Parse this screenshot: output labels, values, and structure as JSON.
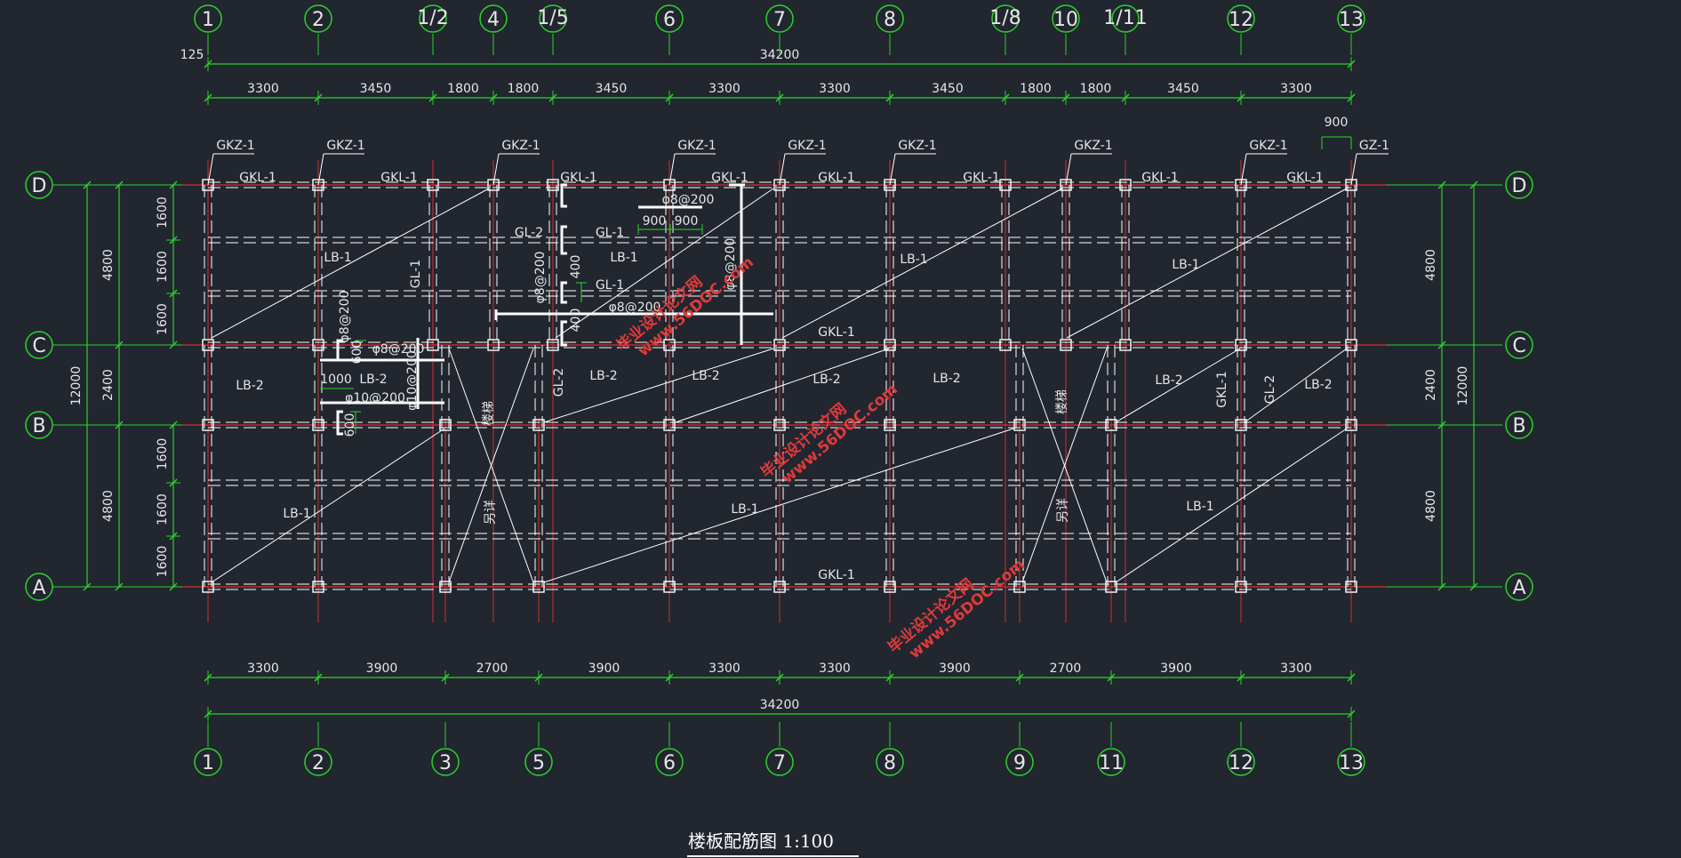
{
  "title": "楼板配筋图 1:100",
  "colors": {
    "background": "#21262f",
    "dimension": "#2bd42b",
    "axis_red": "#d62f2f",
    "beam": "#ffffff",
    "watermark": "#e03a3a"
  },
  "top_axes": [
    "1",
    "2",
    "1/2",
    "4",
    "1/5",
    "6",
    "7",
    "8",
    "1/8",
    "10",
    "1/11",
    "12",
    "13"
  ],
  "bottom_axes": [
    "1",
    "2",
    "3",
    "5",
    "6",
    "7",
    "8",
    "9",
    "11",
    "12",
    "13"
  ],
  "row_axes": [
    "D",
    "C",
    "B",
    "A"
  ],
  "top_overall": "34200",
  "top_offset": "125",
  "top_spans": [
    "3300",
    "3450",
    "1800",
    "1800",
    "3450",
    "3300",
    "3300",
    "3450",
    "1800",
    "1800",
    "3450",
    "3300"
  ],
  "bottom_overall": "34200",
  "bottom_spans": [
    "3300",
    "3900",
    "2700",
    "3900",
    "3300",
    "3300",
    "3900",
    "2700",
    "3900",
    "3300"
  ],
  "left_overall": "12000",
  "left_spans": [
    "4800",
    "2400",
    "4800"
  ],
  "left_sub": [
    "1600",
    "1600",
    "1600",
    "1600",
    "1600",
    "1600"
  ],
  "right_overall": "12000",
  "right_spans": [
    "4800",
    "2400",
    "4800"
  ],
  "col_label": "GKZ-1",
  "corner_col_label": "GZ-1",
  "corner_dim": "900",
  "beams": {
    "top": "GKL-1",
    "mid": "GKL-1",
    "bottom": "GKL-1",
    "vertical": "GKL-1"
  },
  "slabs": {
    "lb1": "LB-1",
    "lb2": "LB-2"
  },
  "gl": {
    "gl1": "GL-1",
    "gl2": "GL-2"
  },
  "stair": {
    "top": "楼梯",
    "bottom": "另详"
  },
  "rebar": {
    "r8": "φ8@200",
    "r10": "φ10@200"
  },
  "details": {
    "d900": "900",
    "d400": "400",
    "d600": "600",
    "d1000": "1000"
  },
  "watermark": {
    "text": "毕业设计论文网",
    "url": "www.56DOC.com"
  }
}
